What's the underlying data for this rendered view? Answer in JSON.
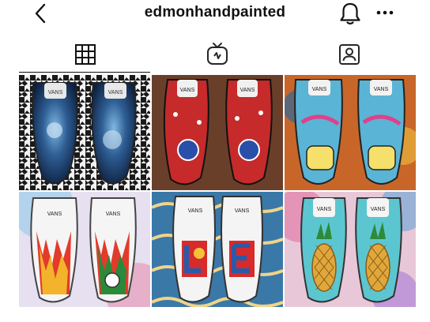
{
  "header": {
    "username": "edmonhandpainted",
    "icons": {
      "back": "chevron-left-icon",
      "notifications": "bell-icon",
      "more": "more-horizontal-icon"
    }
  },
  "tabs": [
    {
      "name": "posts-grid",
      "icon": "grid-icon",
      "selected": true
    },
    {
      "name": "igtv",
      "icon": "igtv-icon",
      "selected": false
    },
    {
      "name": "tagged",
      "icon": "tagged-person-icon",
      "selected": false
    }
  ],
  "posts": [
    {
      "subject": "blue galaxy painted slip-on sneakers on houndstooth background",
      "brand_text": "VANS"
    },
    {
      "subject": "red and blue octopus tentacle painted slip-on sneakers",
      "brand_text": "VANS"
    },
    {
      "subject": "psychedelic camper van painted slip-on sneakers",
      "brand_text": "VANS"
    },
    {
      "subject": "flame pattern painted slip-on sneakers with cartoon character",
      "brand_text": "VANS"
    },
    {
      "subject": "LOVE letters painted slip-on sneakers on patterned fabric",
      "brand_text": "VANS"
    },
    {
      "subject": "pineapple painted slip-on sneakers on tie-dye background",
      "brand_text": "VANS"
    }
  ],
  "colors": {
    "text": "#111111",
    "background": "#ffffff",
    "tab_selected": "#111111",
    "tab_unselected": "#262626"
  }
}
